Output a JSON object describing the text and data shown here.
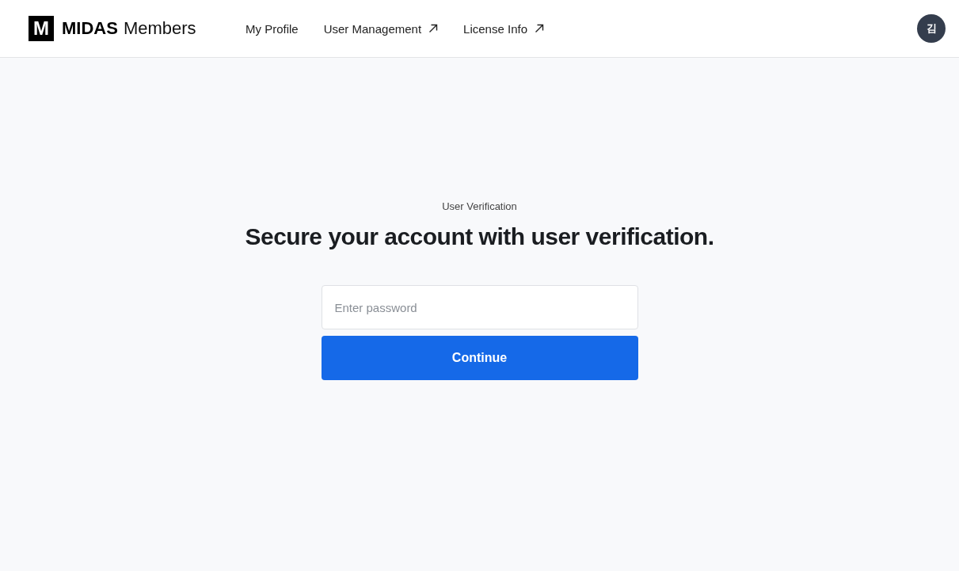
{
  "header": {
    "logo": {
      "mark": "M",
      "brand": "MIDAS",
      "product": "Members"
    },
    "nav": [
      {
        "label": "My Profile",
        "external": false
      },
      {
        "label": "User Management",
        "external": true
      },
      {
        "label": "License Info",
        "external": true
      }
    ],
    "avatar": "김"
  },
  "main": {
    "eyebrow": "User Verification",
    "title": "Secure your account with user verification.",
    "password": {
      "placeholder": "Enter password"
    },
    "button": "Continue"
  }
}
